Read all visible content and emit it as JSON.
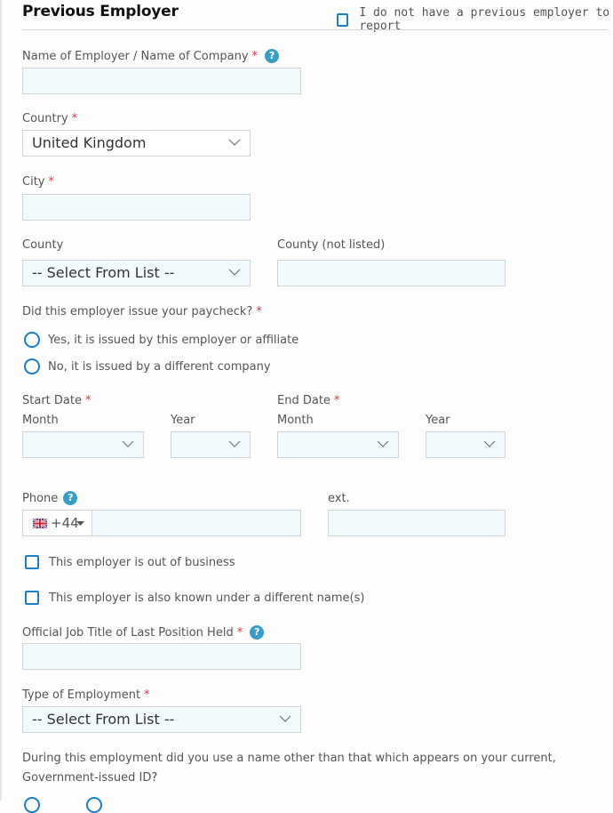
{
  "section": {
    "title": "Previous Employer",
    "no_employer_checkbox": {
      "label": "I do not have a previous employer to report",
      "checked": false
    }
  },
  "fields": {
    "employer_name": {
      "label": "Name of Employer / Name of Company",
      "required": "*",
      "help": "?",
      "value": ""
    },
    "country": {
      "label": "Country",
      "required": "*",
      "value": "United Kingdom"
    },
    "city": {
      "label": "City",
      "required": "*",
      "value": ""
    },
    "county": {
      "label": "County",
      "value": "-- Select From List --"
    },
    "county_not_listed": {
      "label": "County  (not listed)",
      "value": ""
    },
    "paycheck": {
      "label": "Did this employer issue your paycheck?",
      "required": "*",
      "options": [
        {
          "label": "Yes, it is issued by this employer or affiliate",
          "selected": false
        },
        {
          "label": "No, it is issued by a different company",
          "selected": false
        }
      ]
    },
    "start_date": {
      "label": "Start Date",
      "required": "*",
      "month_label": "Month",
      "year_label": "Year",
      "month": "",
      "year": ""
    },
    "end_date": {
      "label": "End Date",
      "required": "*",
      "month_label": "Month",
      "year_label": "Year",
      "month": "",
      "year": ""
    },
    "phone": {
      "label": "Phone",
      "help": "?",
      "country_code": "+44",
      "flag": "uk-flag-icon",
      "value": ""
    },
    "ext": {
      "label": "ext.",
      "value": ""
    },
    "out_of_business": {
      "label": "This employer is out of business",
      "checked": false
    },
    "other_names": {
      "label": "This employer is also known under a different name(s)",
      "checked": false
    },
    "job_title": {
      "label": "Official Job Title of Last Position Held",
      "required": "*",
      "help": "?",
      "value": ""
    },
    "employment_type": {
      "label": "Type of Employment",
      "required": "*",
      "value": "-- Select From List --"
    },
    "other_name_question": {
      "label_line1": "During this employment did you use a name other than that which appears on your current,",
      "label_line2": "Government-issued ID?"
    }
  },
  "colors": {
    "accent": "#1a7fc4",
    "help_icon": "#3a9dc6",
    "required": "#d9343a",
    "input_bg": "#f3fafd"
  }
}
